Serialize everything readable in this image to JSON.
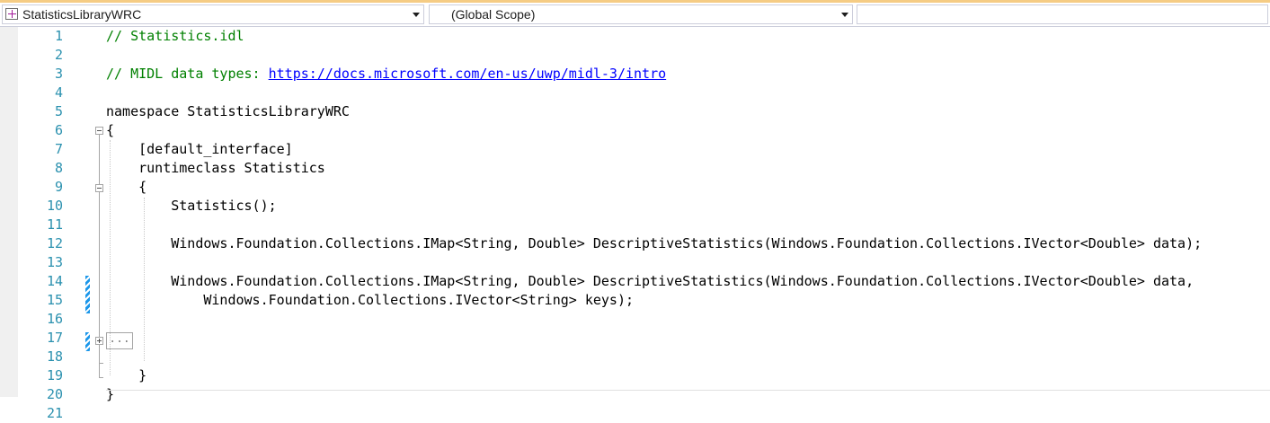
{
  "navbar": {
    "project": "StatisticsLibraryWRC",
    "scope": "(Global Scope)",
    "member": ""
  },
  "editor": {
    "lines": [
      {
        "n": "1",
        "text": "// Statistics.idl"
      },
      {
        "n": "2",
        "text": ""
      },
      {
        "n": "3",
        "text": "// MIDL data types: ",
        "link": "https://docs.microsoft.com/en-us/uwp/midl-3/intro"
      },
      {
        "n": "4",
        "text": ""
      },
      {
        "n": "5",
        "text": "namespace StatisticsLibraryWRC"
      },
      {
        "n": "6",
        "text": "{"
      },
      {
        "n": "7",
        "text": "    [default_interface]"
      },
      {
        "n": "8",
        "text": "    runtimeclass Statistics"
      },
      {
        "n": "9",
        "text": "    {"
      },
      {
        "n": "10",
        "text": "        Statistics();"
      },
      {
        "n": "11",
        "text": ""
      },
      {
        "n": "12",
        "text": "        Windows.Foundation.Collections.IMap<String, Double> DescriptiveStatistics(Windows.Foundation.Collections.IVector<Double> data);"
      },
      {
        "n": "13",
        "text": ""
      },
      {
        "n": "14",
        "text": "        Windows.Foundation.Collections.IMap<String, Double> DescriptiveStatistics(Windows.Foundation.Collections.IVector<Double> data,"
      },
      {
        "n": "15",
        "text": "            Windows.Foundation.Collections.IVector<String> keys);"
      },
      {
        "n": "16",
        "text": ""
      },
      {
        "n": "17",
        "text": ""
      },
      {
        "n": "18",
        "text": ""
      },
      {
        "n": "19",
        "text": "    }"
      },
      {
        "n": "20",
        "text": "}"
      },
      {
        "n": "21",
        "text": ""
      }
    ],
    "collapsed_text": "..."
  },
  "colors": {
    "line_number": "#2b91af",
    "comment": "#008000",
    "link": "#0000ff",
    "change_bar": "#1c97ea"
  }
}
